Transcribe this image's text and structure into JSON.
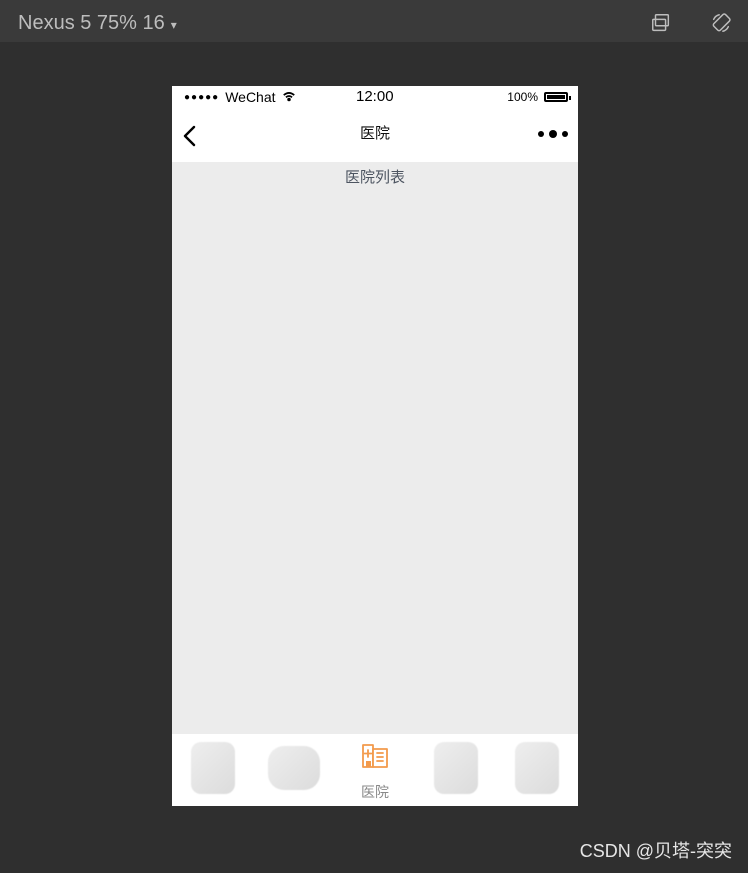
{
  "top": {
    "device_label": "Nexus 5 75% 16",
    "caret": "▾"
  },
  "status": {
    "dots": "●●●●●",
    "carrier": "WeChat",
    "time": "12:00",
    "battery": "100%"
  },
  "nav": {
    "title": "医院"
  },
  "content": {
    "list_title": "医院列表"
  },
  "tabs": [
    {
      "label": ""
    },
    {
      "label": ""
    },
    {
      "label": "医院"
    },
    {
      "label": ""
    },
    {
      "label": ""
    }
  ],
  "watermark": "CSDN @贝塔-突突"
}
